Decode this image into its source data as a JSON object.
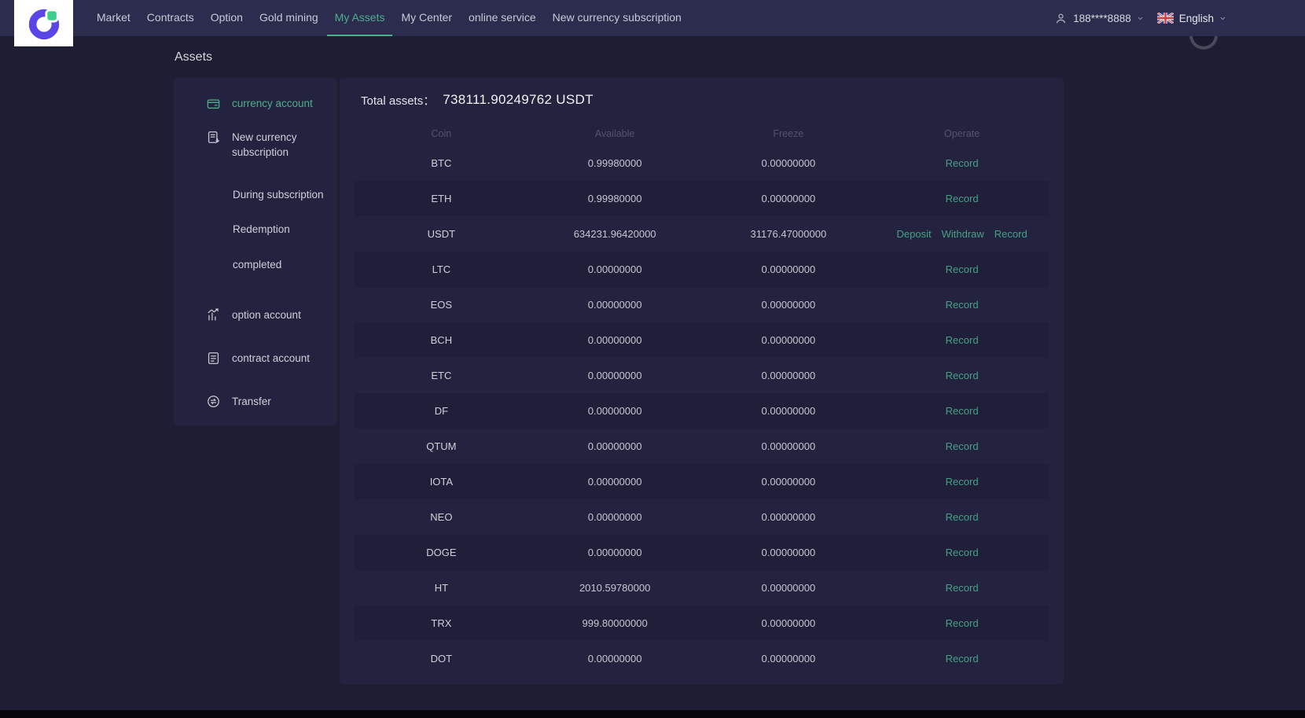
{
  "colors": {
    "accent_green": "#4fae8c",
    "page_bg": "#1d1d33",
    "nav_bg": "#2c2c4e",
    "panel_bg": "#232340",
    "row_stripe": "#1f1f39",
    "logo_purple": "#5a45e6",
    "logo_green": "#3ecf8e"
  },
  "nav": {
    "items": [
      {
        "label": "Market"
      },
      {
        "label": "Contracts"
      },
      {
        "label": "Option"
      },
      {
        "label": "Gold mining"
      },
      {
        "label": "My Assets"
      },
      {
        "label": "My Center"
      },
      {
        "label": "online service"
      },
      {
        "label": "New currency subscription"
      }
    ],
    "active_item": "My Assets",
    "user_phone": "188****8888",
    "language": "English",
    "icons": {
      "user": "user-icon",
      "flag": "uk-flag-icon",
      "chevron": "chevron-down-icon",
      "logo": "brand-logo"
    }
  },
  "page": {
    "title": "Assets"
  },
  "sidebar": {
    "items": [
      {
        "label": "currency account",
        "icon": "wallet",
        "active": true
      },
      {
        "label": "New currency subscription",
        "icon": "subscription",
        "two_line": true
      },
      {
        "label": "During subscription",
        "sub": true
      },
      {
        "label": "Redemption",
        "sub": true
      },
      {
        "label": "completed",
        "sub": true
      },
      {
        "label": "option account",
        "icon": "chart"
      },
      {
        "label": "contract account",
        "icon": "contract"
      },
      {
        "label": "Transfer",
        "icon": "transfer"
      }
    ]
  },
  "assets": {
    "total_label": "Total assets：",
    "total_value": "738111.90249762 USDT",
    "columns": [
      "Coin",
      "Available",
      "Freeze",
      "Operate"
    ],
    "rows": [
      {
        "coin": "BTC",
        "available": "0.99980000",
        "freeze": "0.00000000",
        "actions": [
          "Record"
        ]
      },
      {
        "coin": "ETH",
        "available": "0.99980000",
        "freeze": "0.00000000",
        "actions": [
          "Record"
        ]
      },
      {
        "coin": "USDT",
        "available": "634231.96420000",
        "freeze": "31176.47000000",
        "actions": [
          "Deposit",
          "Withdraw",
          "Record"
        ]
      },
      {
        "coin": "LTC",
        "available": "0.00000000",
        "freeze": "0.00000000",
        "actions": [
          "Record"
        ]
      },
      {
        "coin": "EOS",
        "available": "0.00000000",
        "freeze": "0.00000000",
        "actions": [
          "Record"
        ]
      },
      {
        "coin": "BCH",
        "available": "0.00000000",
        "freeze": "0.00000000",
        "actions": [
          "Record"
        ]
      },
      {
        "coin": "ETC",
        "available": "0.00000000",
        "freeze": "0.00000000",
        "actions": [
          "Record"
        ]
      },
      {
        "coin": "DF",
        "available": "0.00000000",
        "freeze": "0.00000000",
        "actions": [
          "Record"
        ]
      },
      {
        "coin": "QTUM",
        "available": "0.00000000",
        "freeze": "0.00000000",
        "actions": [
          "Record"
        ]
      },
      {
        "coin": "IOTA",
        "available": "0.00000000",
        "freeze": "0.00000000",
        "actions": [
          "Record"
        ]
      },
      {
        "coin": "NEO",
        "available": "0.00000000",
        "freeze": "0.00000000",
        "actions": [
          "Record"
        ]
      },
      {
        "coin": "DOGE",
        "available": "0.00000000",
        "freeze": "0.00000000",
        "actions": [
          "Record"
        ]
      },
      {
        "coin": "HT",
        "available": "2010.59780000",
        "freeze": "0.00000000",
        "actions": [
          "Record"
        ]
      },
      {
        "coin": "TRX",
        "available": "999.80000000",
        "freeze": "0.00000000",
        "actions": [
          "Record"
        ]
      },
      {
        "coin": "DOT",
        "available": "0.00000000",
        "freeze": "0.00000000",
        "actions": [
          "Record"
        ]
      }
    ]
  }
}
